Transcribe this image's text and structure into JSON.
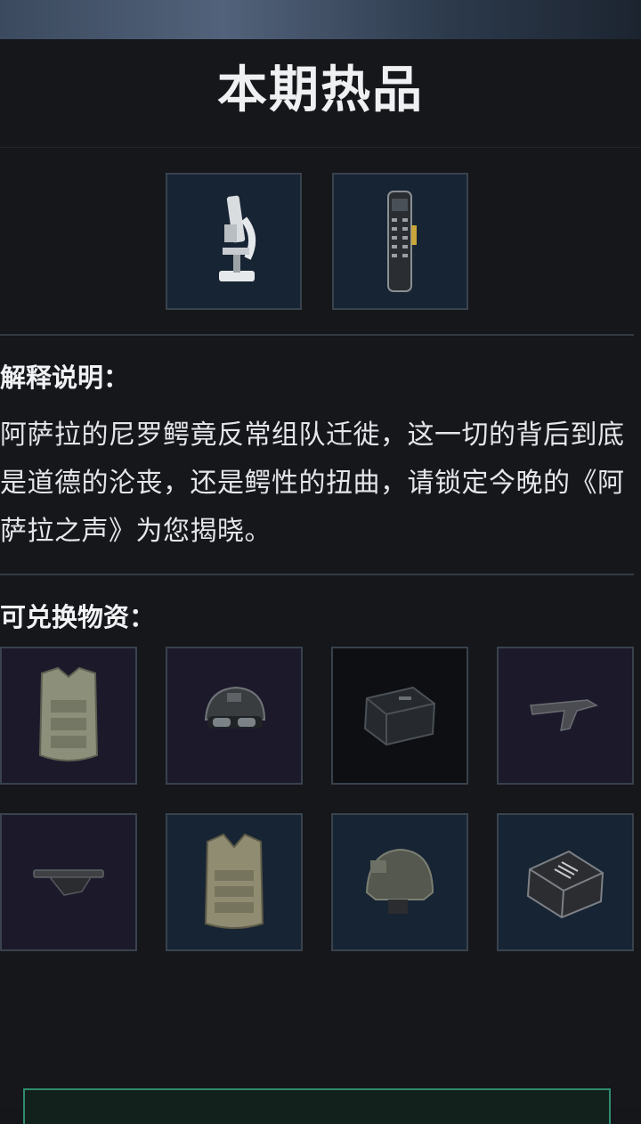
{
  "header": {
    "title": "本期热品"
  },
  "featured_items": [
    {
      "icon": "microscope-icon"
    },
    {
      "icon": "radio-device-icon"
    }
  ],
  "explanation": {
    "label": "解释说明：",
    "text": "阿萨拉的尼罗鳄竟反常组队迁徙，这一切的背后到底是道德的沦丧，还是鳄性的扭曲，请锁定今晚的《阿萨拉之声》为您揭晓。"
  },
  "exchange": {
    "label": "可兑换物资：",
    "items": [
      {
        "icon": "body-armor-icon",
        "bg": "purple"
      },
      {
        "icon": "helmet-goggles-icon",
        "bg": "purple"
      },
      {
        "icon": "ammo-box-icon",
        "bg": "dark"
      },
      {
        "icon": "foregrip-icon",
        "bg": "purple"
      },
      {
        "icon": "angled-grip-icon",
        "bg": "purple"
      },
      {
        "icon": "armor-vest-icon",
        "bg": "blue"
      },
      {
        "icon": "combat-helmet-icon",
        "bg": "blue"
      },
      {
        "icon": "ammo-case-icon",
        "bg": "blue"
      }
    ]
  },
  "colors": {
    "background": "#15171b",
    "slot_border": "#39424d",
    "slot_purple": "#1c1a2a",
    "slot_blue": "#172433",
    "accent_green": "#2f8c6e"
  }
}
